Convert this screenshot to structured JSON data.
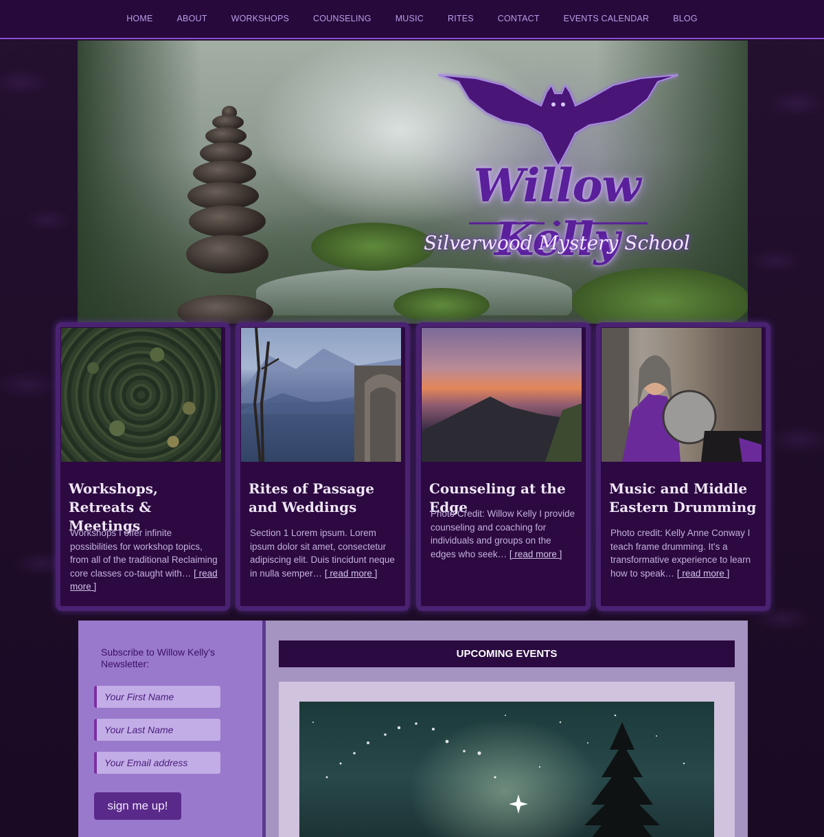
{
  "nav": {
    "items": [
      {
        "label": "HOME"
      },
      {
        "label": "ABOUT"
      },
      {
        "label": "WORKSHOPS"
      },
      {
        "label": "COUNSELING"
      },
      {
        "label": "MUSIC"
      },
      {
        "label": "RITES"
      },
      {
        "label": "CONTACT"
      },
      {
        "label": "EVENTS CALENDAR"
      },
      {
        "label": "BLOG"
      }
    ]
  },
  "hero": {
    "logo_name": "Willow Kelly",
    "tagline": "Silverwood Mystery School",
    "logo_icon": "bat-icon"
  },
  "cards": [
    {
      "title": "Workshops, Retreats & Meetings",
      "text": "Workshops I offer infinite possibilities for workshop topics, from all of the traditional Reclaiming core classes co-taught with…",
      "more": "[ read more ]"
    },
    {
      "title": "Rites of Passage and Weddings",
      "text": "Section 1 Lorem ipsum.  Lorem ipsum dolor sit amet, consectetur adipiscing elit. Duis tincidunt neque in nulla semper…",
      "more": "[ read more ]"
    },
    {
      "title": "Counseling at the Edge",
      "text": "Photo Credit: Willow Kelly I provide counseling and coaching for individuals and groups on the edges who seek…",
      "more": "[ read more ]"
    },
    {
      "title": "Music and Middle Eastern Drumming",
      "text": "Photo credit: Kelly Anne Conway I teach frame drumming. It's a transformative experience to learn how to speak…",
      "more": "[ read more ]"
    }
  ],
  "newsletter": {
    "title": "Subscribe to Willow Kelly's Newsletter:",
    "first_name_placeholder": "Your First Name",
    "last_name_placeholder": "Your Last Name",
    "email_placeholder": "Your Email address",
    "button_label": "sign me up!"
  },
  "events": {
    "heading": "UPCOMING EVENTS"
  },
  "colors": {
    "nav_bg": "#27093b",
    "accent": "#8a4fd0",
    "card_bg": "#2c0940",
    "brand_purple": "#5a1f9a"
  }
}
